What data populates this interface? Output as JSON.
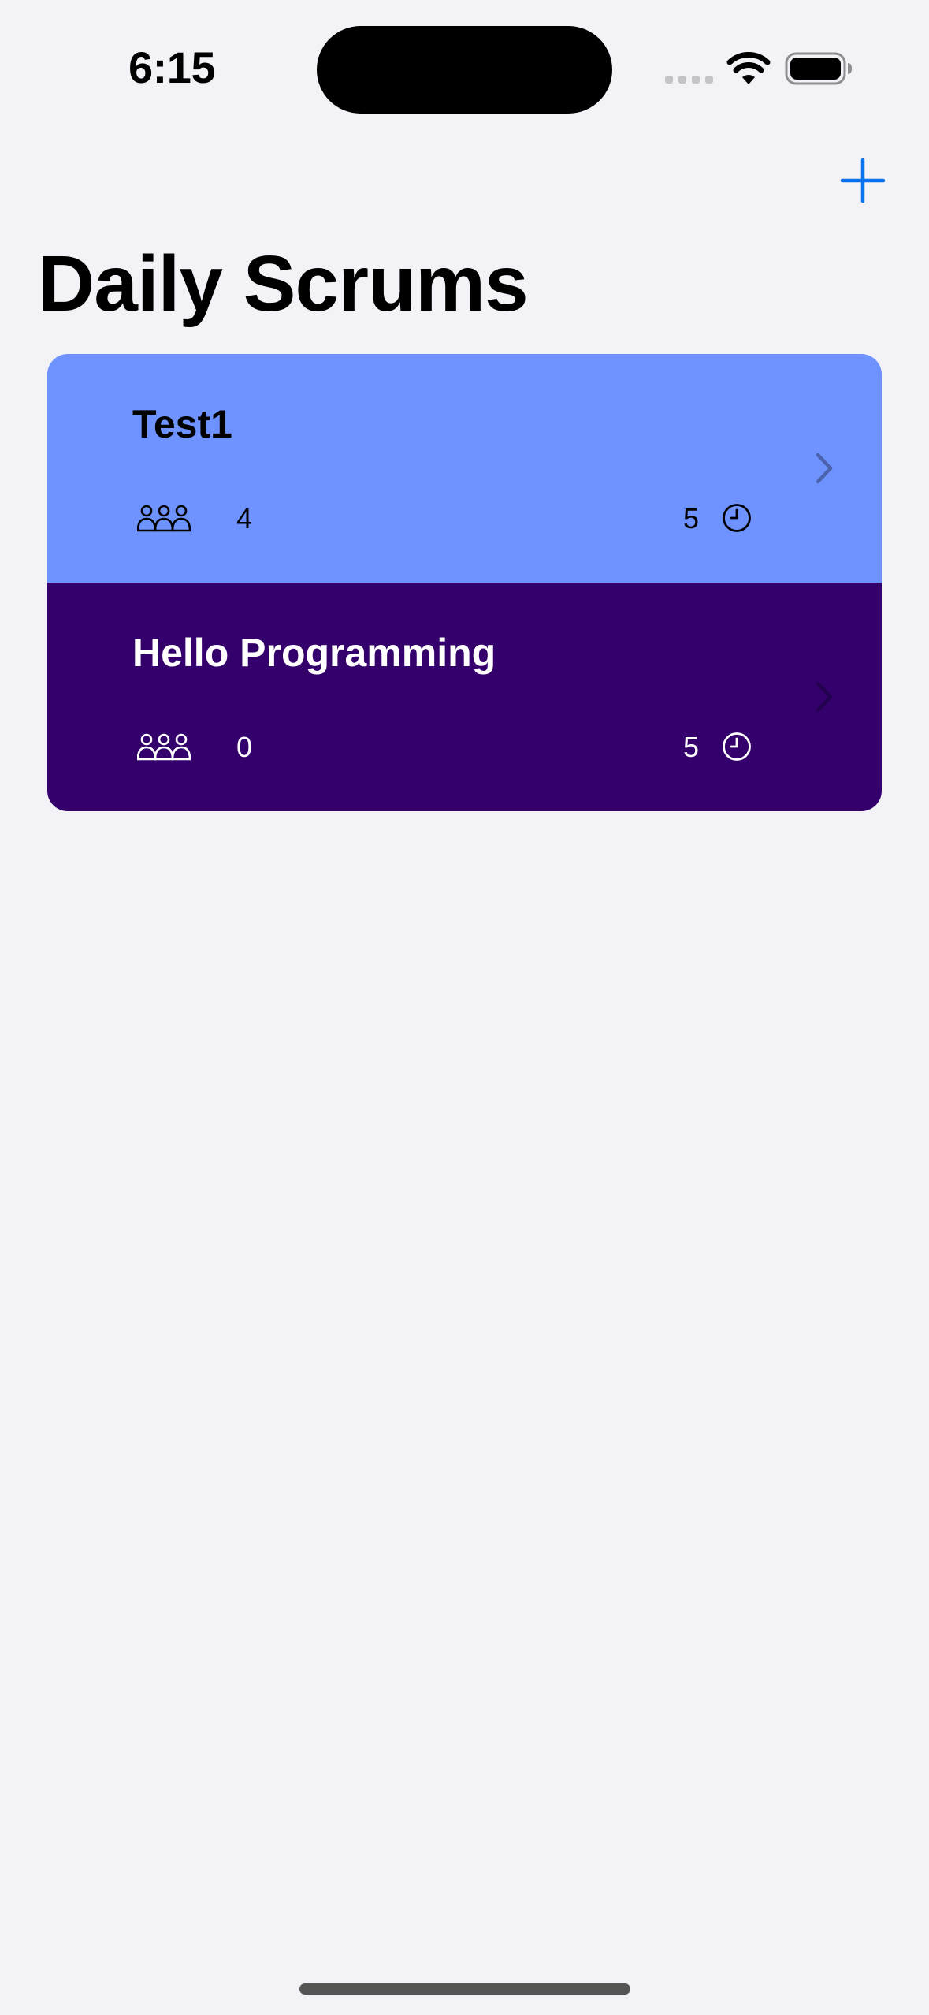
{
  "status_bar": {
    "time": "6:15"
  },
  "nav": {
    "title": "Daily Scrums",
    "add_icon": "plus-icon",
    "accent_color": "#0a73ed"
  },
  "scrums": [
    {
      "title": "Test1",
      "attendees": "4",
      "duration": "5",
      "background": "#6e93ff",
      "text_color": "#000000"
    },
    {
      "title": "Hello Programming",
      "attendees": "0",
      "duration": "5",
      "background": "#34006b",
      "text_color": "#ffffff"
    }
  ]
}
